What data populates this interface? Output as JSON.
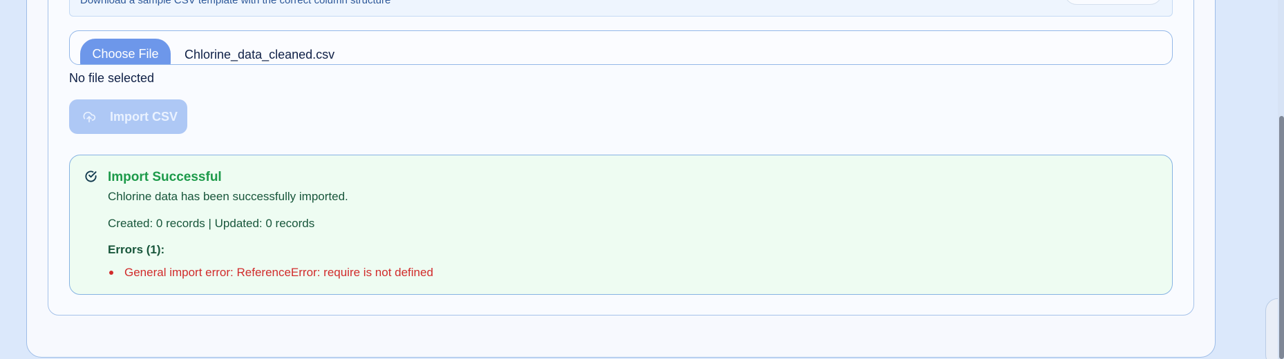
{
  "template": {
    "description": "Download a sample CSV template with the correct column structure"
  },
  "upload": {
    "choose_label": "Choose File",
    "file_name": "Chlorine_data_cleaned.csv",
    "status": "No file selected",
    "import_label": "Import CSV"
  },
  "result": {
    "title": "Import Successful",
    "message": "Chlorine data has been successfully imported.",
    "counts": "Created: 0 records | Updated: 0 records",
    "errors_title": "Errors (1):",
    "errors": [
      "General import error: ReferenceError: require is not defined"
    ]
  },
  "colors": {
    "success": "#1d9a4a",
    "error": "#d12b2b",
    "primary": "#6d97ea"
  }
}
